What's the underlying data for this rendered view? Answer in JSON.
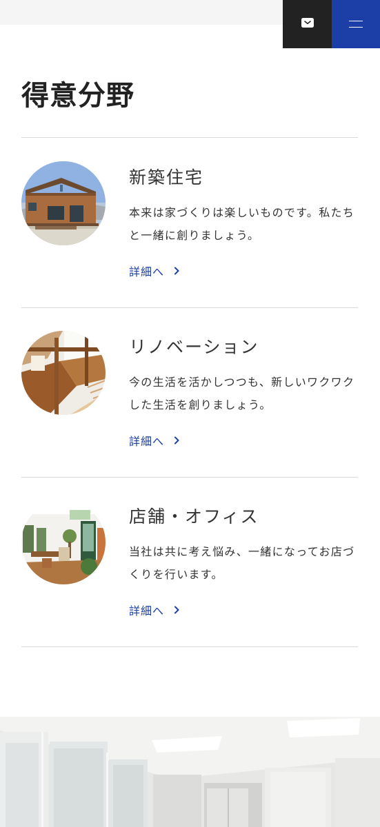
{
  "header": {
    "mail_icon": "mail-icon",
    "menu_icon": "hamburger-icon",
    "accent_color": "#1b3fa6",
    "dark_color": "#222222"
  },
  "section": {
    "title": "得意分野"
  },
  "items": [
    {
      "title": "新築住宅",
      "description": "本来は家づくりは楽しいものです。私たちと一緒に創りましょう。",
      "link": "詳細へ"
    },
    {
      "title": "リノベーション",
      "description": "今の生活を活かしつつも、新しいワクワクした生活を創りましょう。",
      "link": "詳細へ"
    },
    {
      "title": "店舗・オフィス",
      "description": "当社は共に考え悩み、一緒になってお店づくりを行います。",
      "link": "詳細へ"
    }
  ]
}
